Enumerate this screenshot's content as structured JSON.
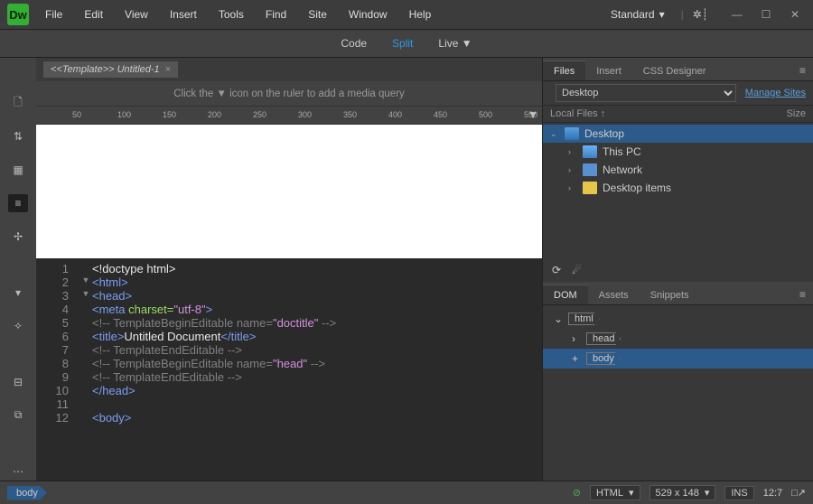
{
  "menubar": {
    "items": [
      "File",
      "Edit",
      "View",
      "Insert",
      "Tools",
      "Find",
      "Site",
      "Window",
      "Help"
    ],
    "workspace": "Standard"
  },
  "viewbar": {
    "code": "Code",
    "split": "Split",
    "live": "Live"
  },
  "doc": {
    "tab": "<<Template>> Untitled-1",
    "hint": "Click the ▼ icon on the ruler to add a media query"
  },
  "ruler": {
    "ticks": [
      "50",
      "100",
      "150",
      "200",
      "250",
      "300",
      "350",
      "400",
      "450",
      "500",
      "550"
    ]
  },
  "code": {
    "lines": [
      {
        "n": "1",
        "html": "<span class='txt'>&lt;!doctype html&gt;</span>"
      },
      {
        "n": "2",
        "fold": "▼",
        "html": "<span class='tag'>&lt;html&gt;</span>"
      },
      {
        "n": "3",
        "fold": "▼",
        "html": "<span class='tag'>&lt;head&gt;</span>"
      },
      {
        "n": "4",
        "html": "<span class='tag'>&lt;meta</span> <span class='attr'>charset=</span><span class='val'>\"utf-8\"</span><span class='tag'>&gt;</span>"
      },
      {
        "n": "5",
        "html": "<span class='cmt'>&lt;!-- TemplateBeginEditable name=</span><span class='val'>\"doctitle\"</span><span class='cmt'> --&gt;</span>"
      },
      {
        "n": "6",
        "html": "<span class='tag'>&lt;title&gt;</span><span class='txt'>Untitled Document</span><span class='tag'>&lt;/title&gt;</span>"
      },
      {
        "n": "7",
        "html": "<span class='cmt'>&lt;!-- TemplateEndEditable --&gt;</span>"
      },
      {
        "n": "8",
        "html": "<span class='cmt'>&lt;!-- TemplateBeginEditable name=</span><span class='val'>\"head\"</span><span class='cmt'> --&gt;</span>"
      },
      {
        "n": "9",
        "html": "<span class='cmt'>&lt;!-- TemplateEndEditable --&gt;</span>"
      },
      {
        "n": "10",
        "html": "<span class='tag'>&lt;/head&gt;</span>"
      },
      {
        "n": "11",
        "html": ""
      },
      {
        "n": "12",
        "html": "<span class='tag'>&lt;body&gt;</span>"
      }
    ]
  },
  "panels": {
    "filesTabs": [
      "Files",
      "Insert",
      "CSS Designer"
    ],
    "site": "Desktop",
    "manage": "Manage Sites",
    "colLocal": "Local Files ↑",
    "colSize": "Size",
    "tree": [
      {
        "indent": 0,
        "arrow": "⌄",
        "icon": "icon-desktop",
        "label": "Desktop",
        "sel": true
      },
      {
        "indent": 1,
        "arrow": "›",
        "icon": "icon-pc",
        "label": "This PC"
      },
      {
        "indent": 1,
        "arrow": "›",
        "icon": "icon-net",
        "label": "Network"
      },
      {
        "indent": 1,
        "arrow": "›",
        "icon": "icon-folder",
        "label": "Desktop items"
      }
    ],
    "domTabs": [
      "DOM",
      "Assets",
      "Snippets"
    ],
    "dom": [
      {
        "indent": 0,
        "arrow": "⌄",
        "tag": "html"
      },
      {
        "indent": 1,
        "arrow": "›",
        "tag": "head"
      },
      {
        "indent": 1,
        "plus": true,
        "tag": "body",
        "sel": true
      }
    ]
  },
  "status": {
    "crumb": "body",
    "lang": "HTML",
    "dims": "529 x 148",
    "ins": "INS",
    "pos": "12:7"
  }
}
